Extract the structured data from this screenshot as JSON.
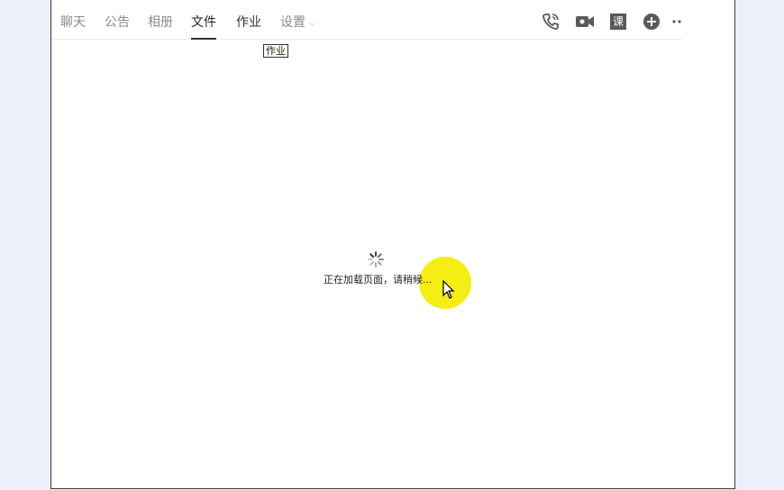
{
  "tabs": [
    {
      "label": "聊天"
    },
    {
      "label": "公告"
    },
    {
      "label": "相册"
    },
    {
      "label": "文件"
    },
    {
      "label": "作业"
    },
    {
      "label": "设置"
    }
  ],
  "tooltip": "作业",
  "loading": {
    "text": "正在加载页面，请稍候..."
  },
  "icons": {
    "call": "phone-icon",
    "video": "video-camera-icon",
    "lesson": "课",
    "add": "add-circle-icon",
    "more": "more-dots-icon"
  },
  "colors": {
    "accent": "#333333",
    "icon": "#5a5a5a",
    "cursor_highlight": "#f5ec00"
  }
}
